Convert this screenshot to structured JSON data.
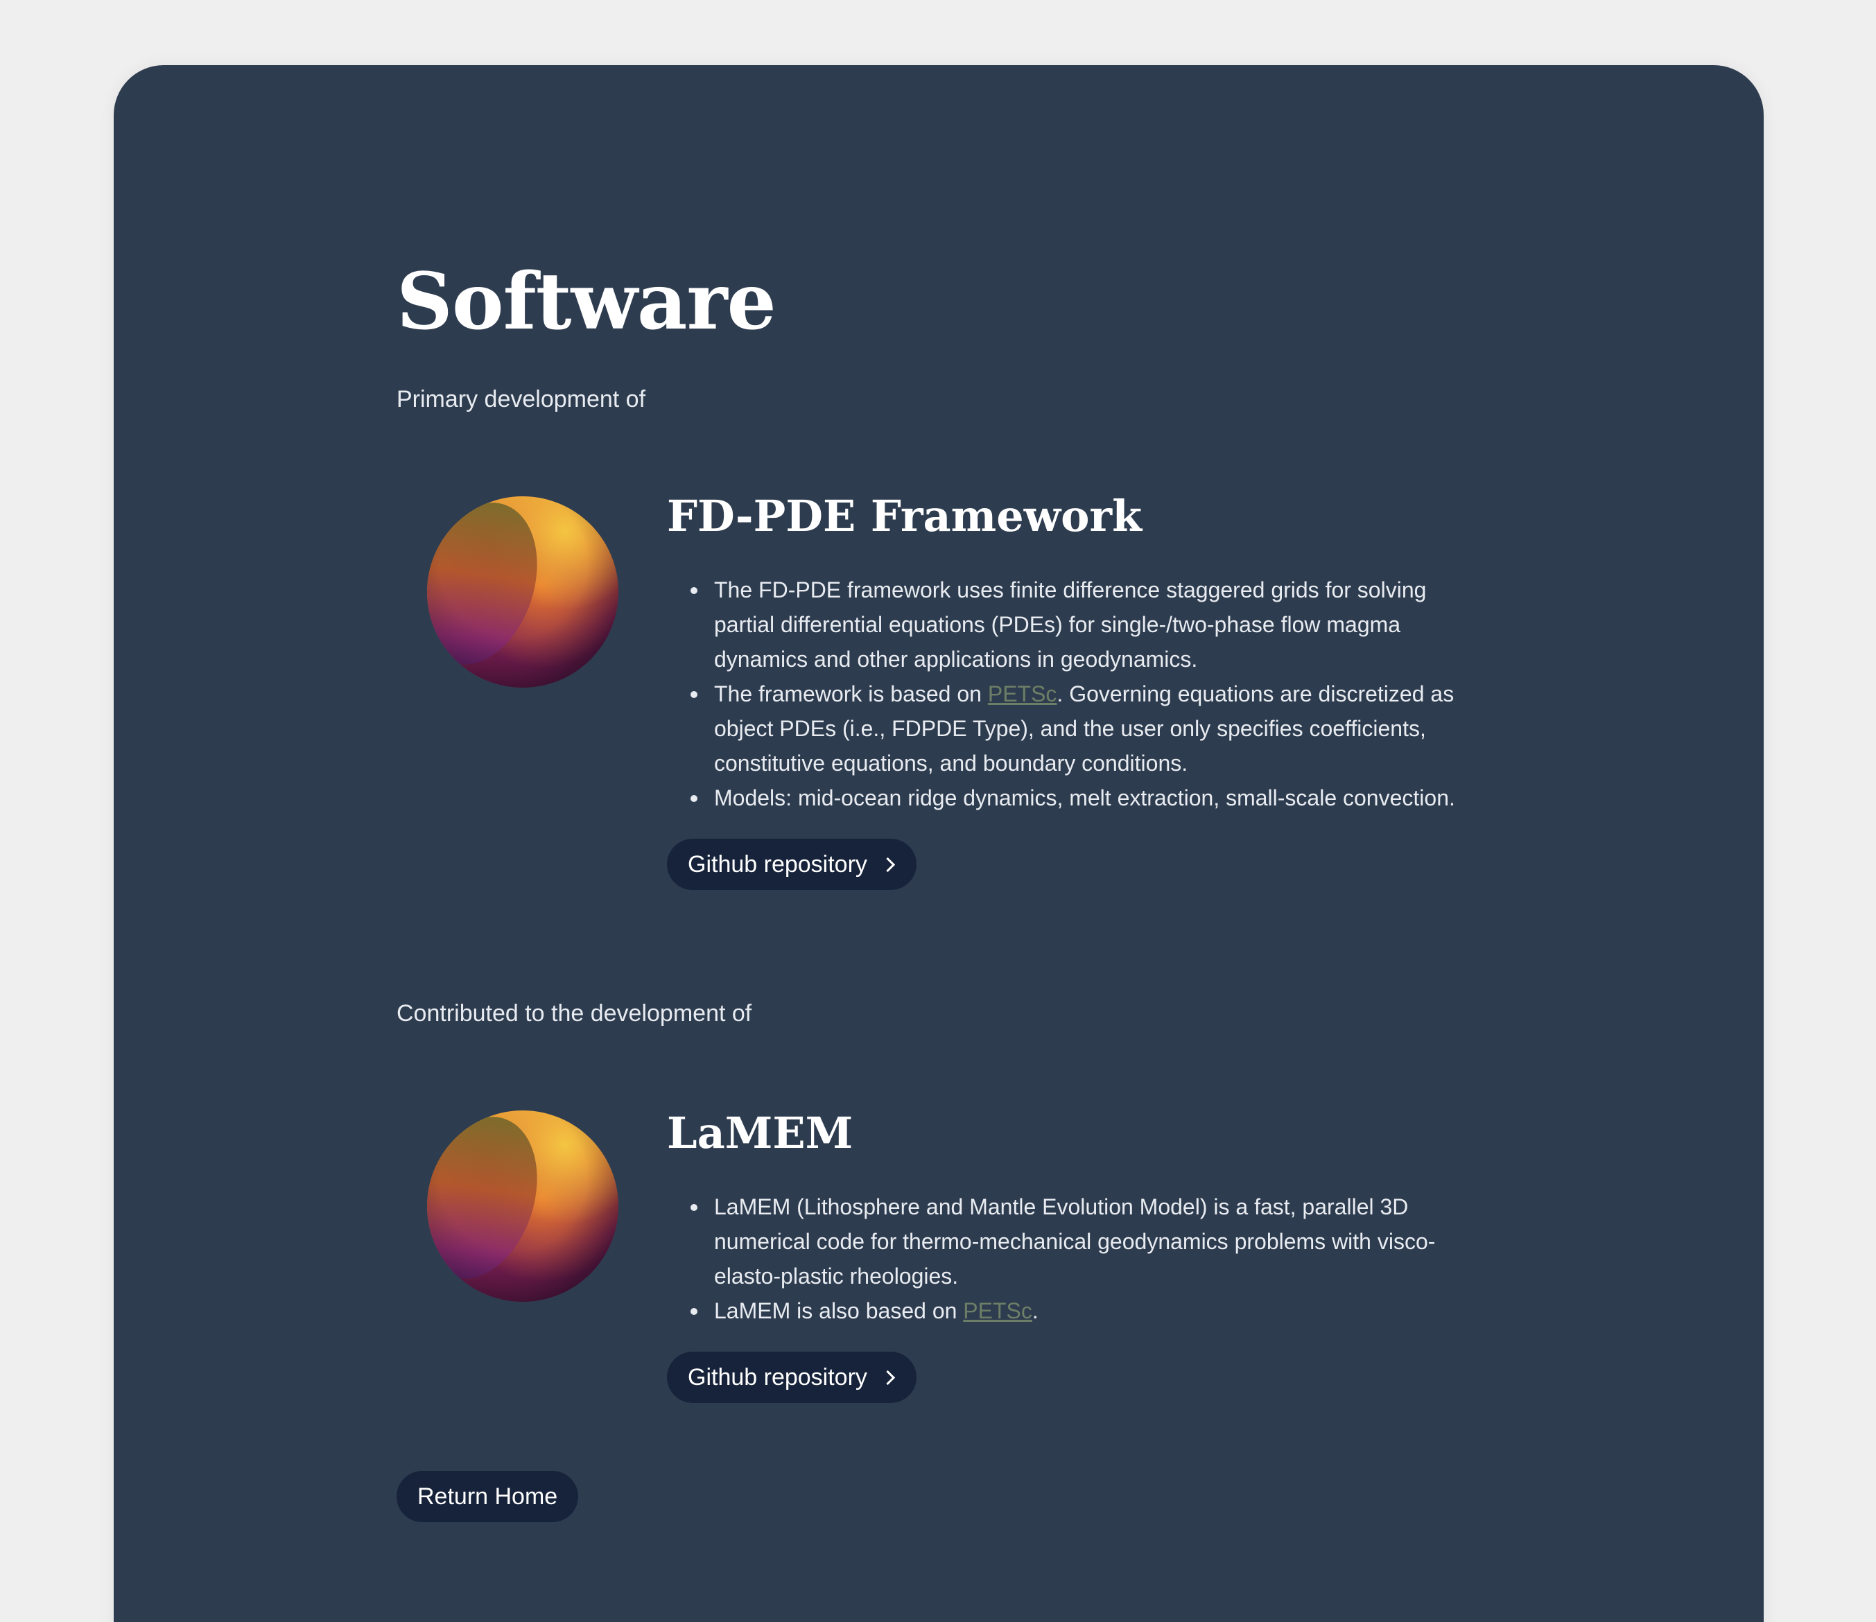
{
  "page": {
    "title": "Software",
    "primary_label": "Primary development of",
    "contributed_label": "Contributed to the development of",
    "return_home": "Return Home"
  },
  "projects": [
    {
      "title": "FD-PDE Framework",
      "icon": "gradient-sphere-icon",
      "bullets": [
        {
          "text": "The FD-PDE framework uses finite difference staggered grids for solving partial differential equations (PDEs) for single-/two-phase flow magma dynamics and other applications in geodynamics."
        },
        {
          "before": "The framework is based on ",
          "link": "PETSc",
          "after": ". Governing equations are discretized as object PDEs (i.e., FDPDE Type), and the user only specifies coefficients, constitutive equations, and boundary conditions."
        },
        {
          "text": "Models: mid-ocean ridge dynamics, melt extraction, small-scale convection."
        }
      ],
      "button": "Github repository"
    },
    {
      "title": "LaMEM",
      "icon": "gradient-sphere-icon",
      "bullets": [
        {
          "text": "LaMEM (Lithosphere and Mantle Evolution Model) is a fast, parallel 3D numerical code for thermo-mechanical geodynamics problems with visco-elasto-plastic rheologies."
        },
        {
          "before": "LaMEM is also based on ",
          "link": "PETSc",
          "after": "."
        }
      ],
      "button": "Github repository"
    }
  ],
  "colors": {
    "page_bg": "#efefef",
    "card_bg": "#2e3c4f",
    "button_bg": "#17233a",
    "link": "#6c7f66",
    "text": "#e8ecf1"
  }
}
